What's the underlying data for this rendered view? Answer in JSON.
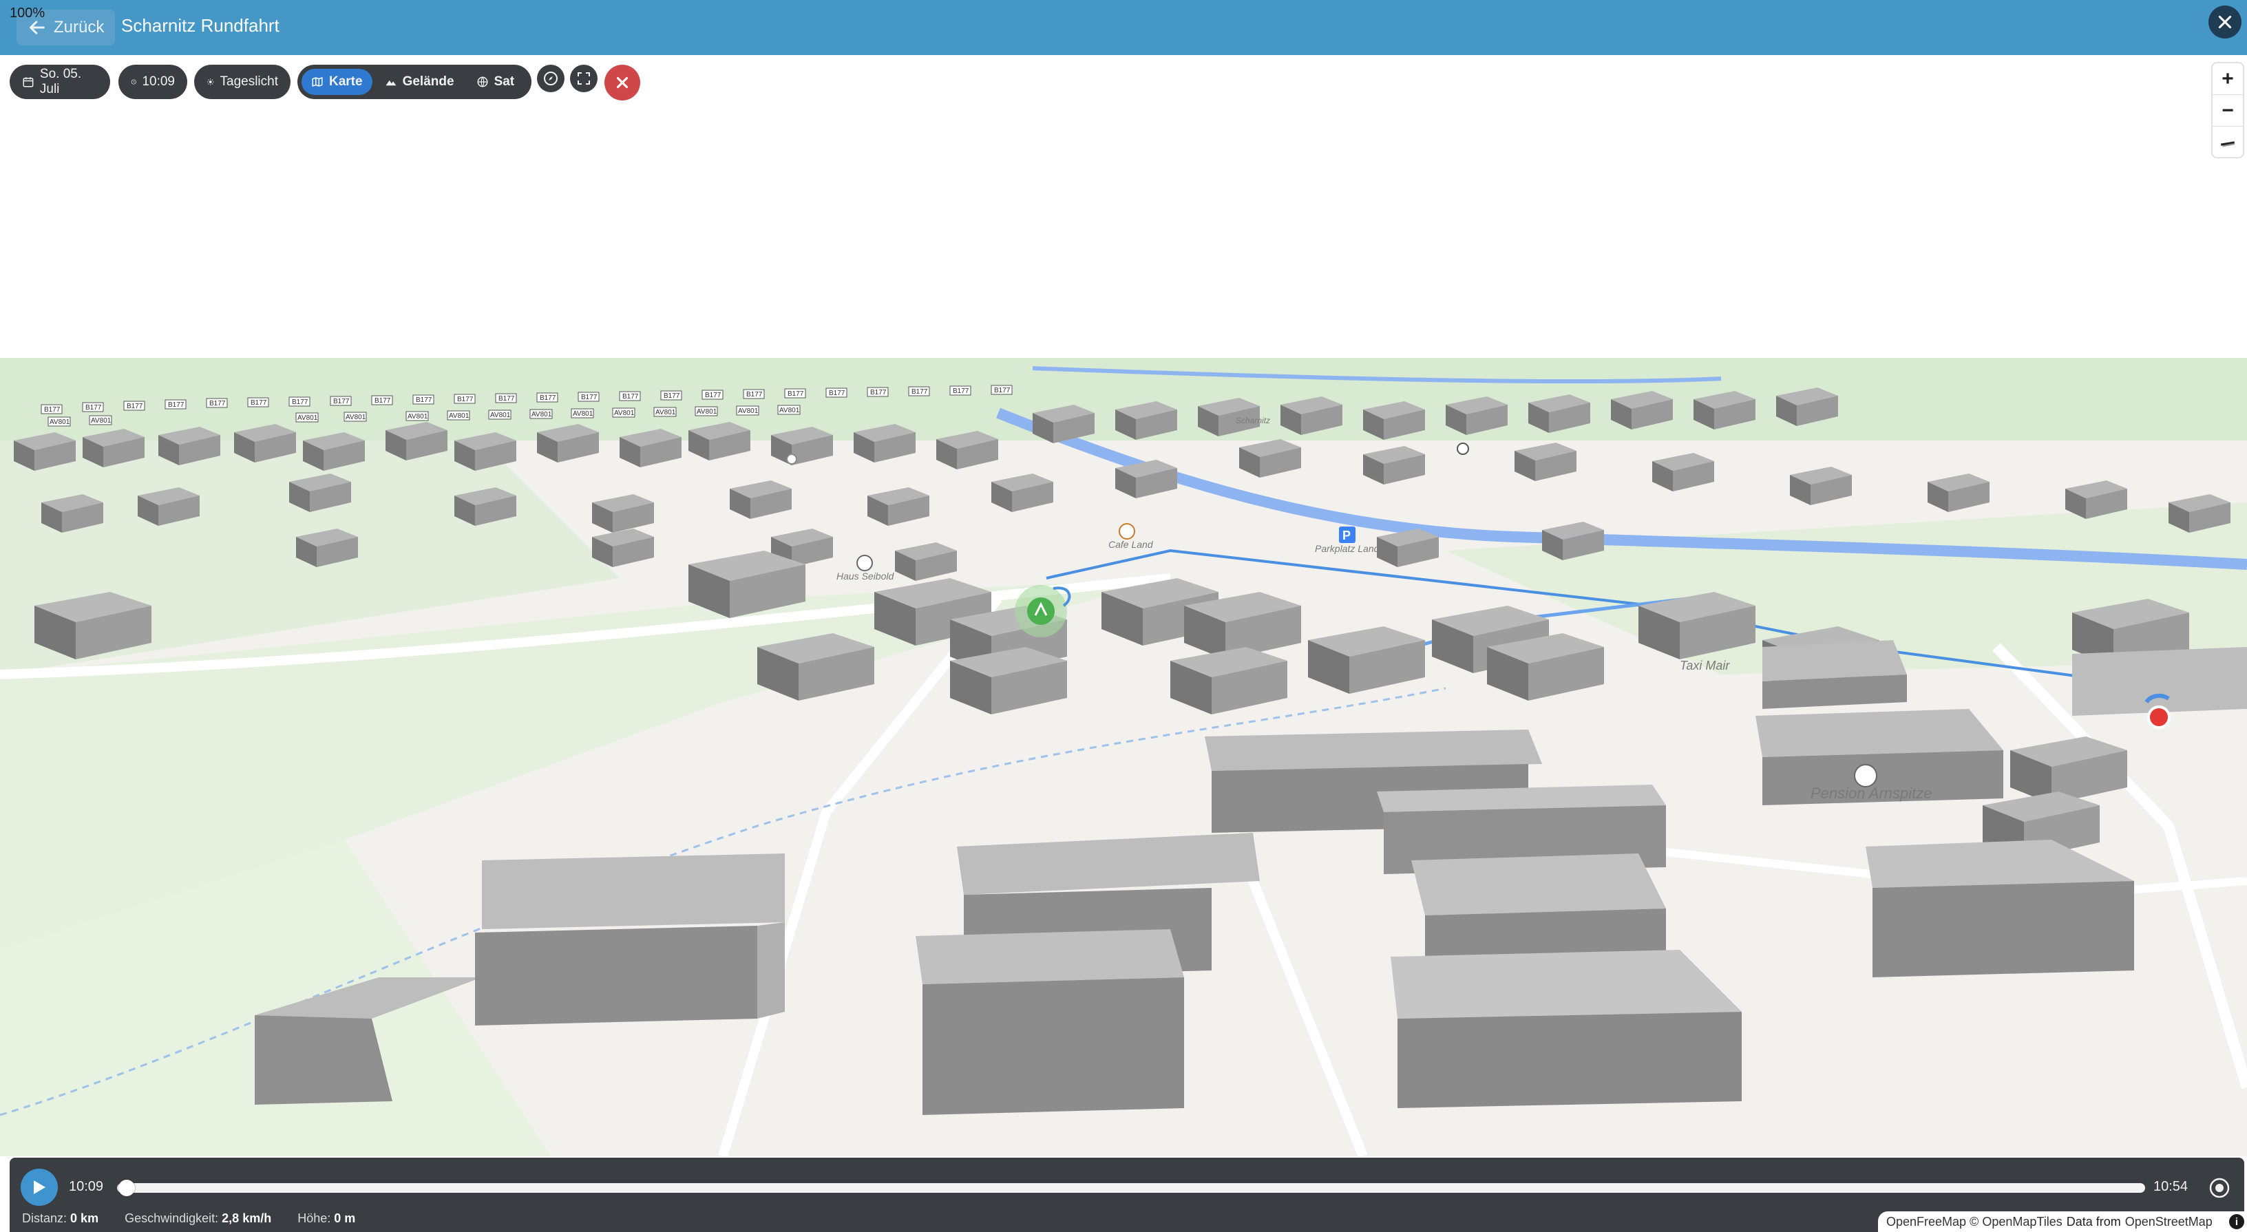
{
  "header": {
    "zoom_level": "100%",
    "back_label": "Zurück",
    "title": "Scharnitz Rundfahrt"
  },
  "toolbar": {
    "date": "So. 05. Juli",
    "time": "10:09",
    "light": "Tageslicht",
    "layers": [
      {
        "label": "Karte",
        "active": true
      },
      {
        "label": "Gelände",
        "active": false
      },
      {
        "label": "Sat",
        "active": false
      }
    ]
  },
  "zoom": {
    "plus": "+",
    "minus": "−"
  },
  "map": {
    "labels": {
      "cafe": "Cafe Land",
      "parking": "Parkplatz Land",
      "haus": "Haus Seibold",
      "taxi": "Taxi Mair",
      "pension": "Pension Arnspitze",
      "town": "Scharnitz"
    },
    "road_shields": [
      "B177",
      "AV801"
    ],
    "accent_colors": {
      "water": "#8db4f0",
      "route": "#4a90e2",
      "start_marker": "#4caf50",
      "end_marker": "#e53935",
      "parking": "#3b82f6"
    }
  },
  "player": {
    "start_time": "10:09",
    "end_time": "10:54",
    "progress": 0,
    "distance_label": "Distanz:",
    "distance_value": "0 km",
    "speed_label": "Geschwindigkeit:",
    "speed_value": "2,8 km/h",
    "height_label": "Höhe:",
    "height_value": "0 m"
  },
  "attribution": {
    "omt": "OpenFreeMap © OpenMapTiles",
    "data_from": "Data from",
    "osm": "OpenStreetMap",
    "info": "i"
  }
}
